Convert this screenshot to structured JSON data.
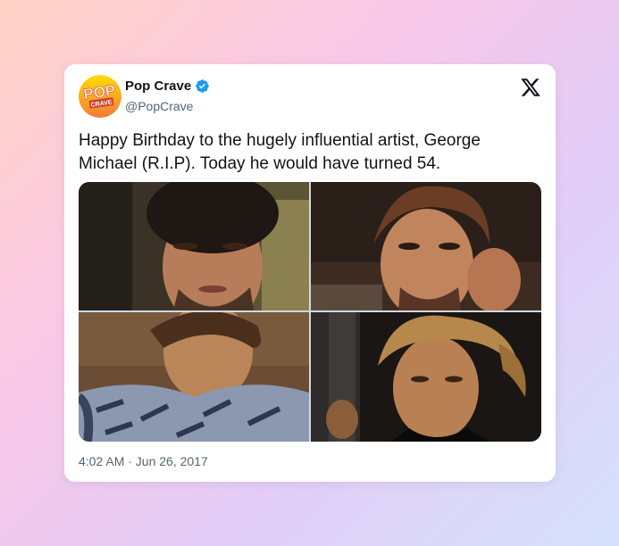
{
  "tweet": {
    "author": {
      "display_name": "Pop Crave",
      "handle": "@PopCrave",
      "verified": true,
      "avatar_logo_text": [
        "POP",
        "CRAVE"
      ]
    },
    "text": "Happy Birthday to the hugely influential artist, George Michael (R.I.P). Today he would have turned 54.",
    "media": [
      {
        "subject": "portrait-photo"
      },
      {
        "subject": "portrait-photo"
      },
      {
        "subject": "portrait-photo"
      },
      {
        "subject": "portrait-photo"
      }
    ],
    "timestamp": "4:02 AM · Jun 26, 2017"
  },
  "icons": {
    "verified": "verified-badge-icon",
    "platform": "x-logo-icon"
  },
  "colors": {
    "verified_blue": "#1d9bf0",
    "text_primary": "#0f1419",
    "text_secondary": "#536471",
    "avatar_yellow": "#ffd400",
    "avatar_orange": "#f47a3c"
  }
}
